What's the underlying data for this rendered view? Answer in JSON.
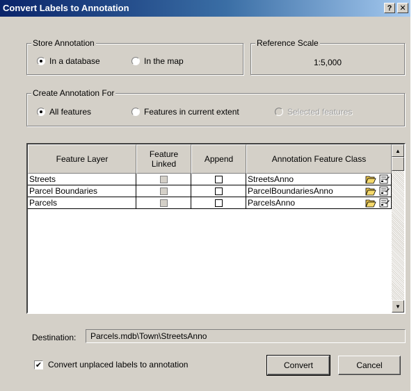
{
  "window": {
    "title": "Convert Labels to Annotation",
    "help_label": "?",
    "close_label": "✕"
  },
  "store_annotation": {
    "label": "Store Annotation",
    "options": [
      {
        "label": "In a database",
        "selected": true
      },
      {
        "label": "In the map",
        "selected": false
      }
    ]
  },
  "reference_scale": {
    "label": "Reference Scale",
    "value": "1:5,000"
  },
  "create_for": {
    "label": "Create Annotation For",
    "options": [
      {
        "label": "All features",
        "selected": true,
        "enabled": true
      },
      {
        "label": "Features in current extent",
        "selected": false,
        "enabled": true
      },
      {
        "label": "Selected features",
        "selected": false,
        "enabled": false
      }
    ]
  },
  "table": {
    "columns": [
      "Feature Layer",
      "Feature Linked",
      "Append",
      "Annotation Feature Class"
    ],
    "rows": [
      {
        "layer": "Streets",
        "feature_linked": false,
        "append": false,
        "class": "StreetsAnno"
      },
      {
        "layer": "Parcel Boundaries",
        "feature_linked": false,
        "append": false,
        "class": "ParcelBoundariesAnno"
      },
      {
        "layer": "Parcels",
        "feature_linked": false,
        "append": false,
        "class": "ParcelsAnno"
      }
    ],
    "row_icons": [
      "folder-open-icon",
      "properties-icon"
    ]
  },
  "destination": {
    "label": "Destination:",
    "value": "Parcels.mdb\\Town\\StreetsAnno"
  },
  "convert_unplaced": {
    "label": "Convert unplaced labels to annotation",
    "checked": true,
    "check_mark": "✔"
  },
  "buttons": {
    "convert": "Convert",
    "cancel": "Cancel"
  },
  "colors": {
    "title_start": "#0a246a",
    "title_end": "#a6caf0",
    "face": "#d4d0c8"
  }
}
